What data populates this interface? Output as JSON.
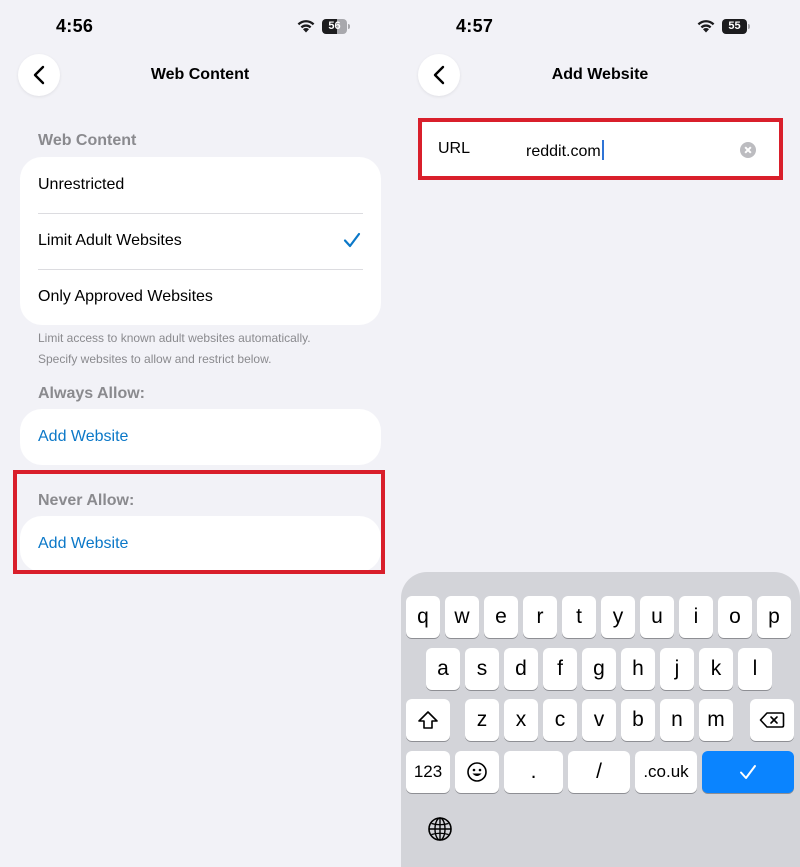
{
  "left": {
    "time": "4:56",
    "battery": "56",
    "nav_title": "Web Content",
    "section_header": "Web Content",
    "options": [
      {
        "label": "Unrestricted",
        "selected": false
      },
      {
        "label": "Limit Adult Websites",
        "selected": true
      },
      {
        "label": "Only Approved Websites",
        "selected": false
      }
    ],
    "footnote_line1": "Limit access to known adult websites automatically.",
    "footnote_line2": "Specify websites to allow and restrict below.",
    "always_allow_header": "Always Allow:",
    "always_allow_add": "Add Website",
    "never_allow_header": "Never Allow:",
    "never_allow_add": "Add Website"
  },
  "right": {
    "time": "4:57",
    "battery": "55",
    "nav_title": "Add Website",
    "url_label": "URL",
    "url_value": "reddit.com"
  },
  "keyboard": {
    "row1": [
      "q",
      "w",
      "e",
      "r",
      "t",
      "y",
      "u",
      "i",
      "o",
      "p"
    ],
    "row2": [
      "a",
      "s",
      "d",
      "f",
      "g",
      "h",
      "j",
      "k",
      "l"
    ],
    "row3": [
      "z",
      "x",
      "c",
      "v",
      "b",
      "n",
      "m"
    ],
    "numbers_key": "123",
    "dot_key": ".",
    "slash_key": "/",
    "couk_key": ".co.uk",
    "icons": [
      "shift-icon",
      "backspace-icon",
      "emoji-icon",
      "checkmark-icon",
      "globe-icon"
    ]
  },
  "colors": {
    "accent": "#0b78c8",
    "highlight": "#d91f2b",
    "return_key": "#0a84ff"
  }
}
